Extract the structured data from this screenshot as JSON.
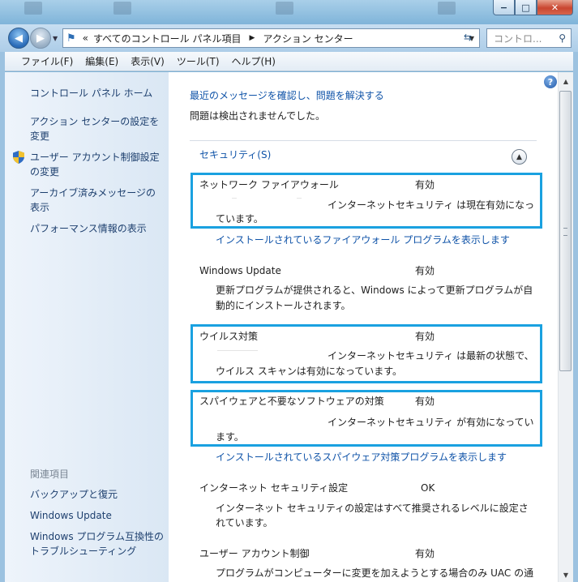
{
  "window": {
    "minimize_glyph": "−",
    "maximize_glyph": "□",
    "close_glyph": "✕"
  },
  "address": {
    "overflow": "«",
    "crumbs": [
      "すべてのコントロール パネル項目",
      "アクション センター"
    ],
    "search_placeholder": "コントロ..."
  },
  "menu": [
    "ファイル(F)",
    "編集(E)",
    "表示(V)",
    "ツール(T)",
    "ヘルプ(H)"
  ],
  "sidebar": {
    "home": "コントロール パネル ホーム",
    "settings_1": "アクション センターの設定を",
    "settings_2": "変更",
    "uac_1": "ユーザー アカウント制御設定",
    "uac_2": "の変更",
    "archive_1": "アーカイブ済みメッセージの",
    "archive_2": "表示",
    "performance": "パフォーマンス情報の表示",
    "related_title": "関連項目",
    "backup": "バックアップと復元",
    "windows_update": "Windows Update",
    "compat_1": "Windows プログラム互換性の",
    "compat_2": "トラブルシューティング"
  },
  "main": {
    "heading": "最近のメッセージを確認し、問題を解決する",
    "no_problems": "問題は検出されませんでした。",
    "security_title": "セキュリティ(S)",
    "items": {
      "firewall": {
        "name": "ネットワーク ファイアウォール",
        "status": "有効",
        "desc_1": "インターネットセキュリティ は現在有効になっ",
        "desc_2": "ています。",
        "link": "インストールされているファイアウォール プログラムを表示します"
      },
      "update": {
        "name": "Windows Update",
        "status": "有効",
        "desc_1": "更新プログラムが提供されると、Windows によって更新プログラムが自",
        "desc_2": "動的にインストールされます。"
      },
      "virus": {
        "name": "ウイルス対策",
        "status": "有効",
        "desc_1": "インターネットセキュリティ は最新の状態で、",
        "desc_2": "ウイルス スキャンは有効になっています。"
      },
      "spyware": {
        "name": "スパイウェアと不要なソフトウェアの対策",
        "status": "有効",
        "desc_1": "インターネットセキュリティ が有効になってい",
        "desc_2": "ます。",
        "link": "インストールされているスパイウェア対策プログラムを表示します"
      },
      "inet": {
        "name": "インターネット セキュリティ設定",
        "status": "OK",
        "desc_1": "インターネット セキュリティの設定はすべて推奨されるレベルに設定さ",
        "desc_2": "れています。"
      },
      "uac": {
        "name": "ユーザー アカウント制御",
        "status": "有効",
        "desc_1": "プログラムがコンピューターに変更を加えようとする場合のみ UAC の通"
      }
    }
  },
  "colors": {
    "highlight": "#1aa1e0",
    "link": "#0f53a8",
    "sidebar_link": "#1d3f6e"
  }
}
